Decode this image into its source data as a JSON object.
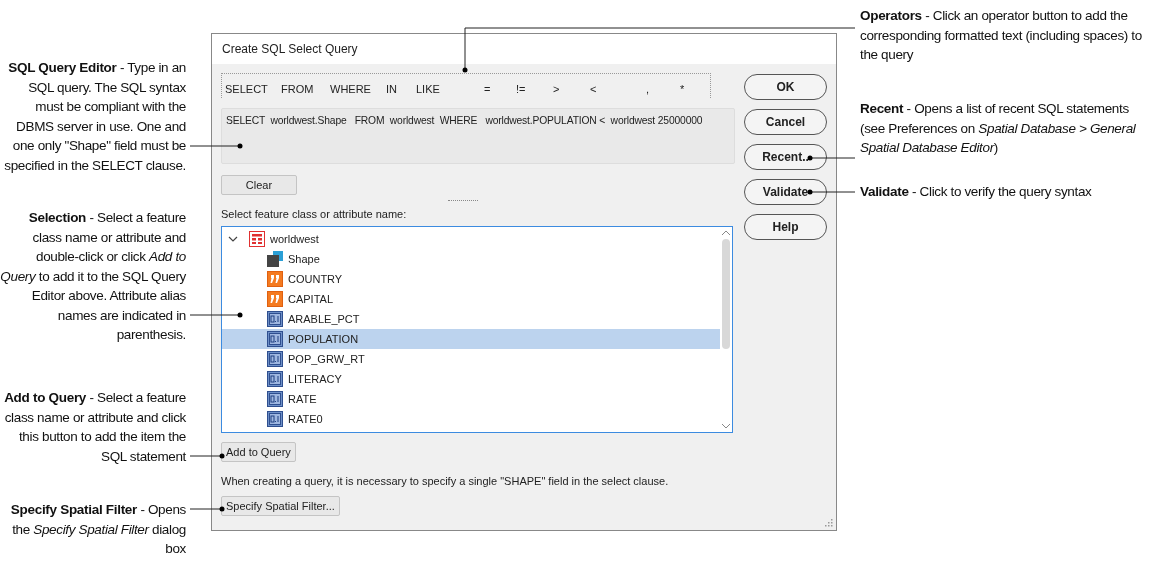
{
  "dialog": {
    "title": "Create SQL Select Query",
    "operators": [
      "SELECT",
      "FROM",
      "WHERE",
      "IN",
      "LIKE",
      "=",
      "!=",
      ">",
      "<",
      ",",
      "*"
    ],
    "query": "SELECT  worldwest.Shape   FROM  worldwest  WHERE   worldwest.POPULATION <  worldwest 25000000",
    "clear_button": "Clear",
    "tree_label": "Select feature class or attribute name:",
    "tree": {
      "label": "worldwest",
      "kind": "feature_class",
      "expanded": true,
      "selected": false,
      "children": [
        {
          "label": "Shape",
          "kind": "shape",
          "selected": false
        },
        {
          "label": "COUNTRY",
          "kind": "text",
          "selected": false
        },
        {
          "label": "CAPITAL",
          "kind": "text",
          "selected": false
        },
        {
          "label": "ARABLE_PCT",
          "kind": "number",
          "selected": false
        },
        {
          "label": "POPULATION",
          "kind": "number",
          "selected": true
        },
        {
          "label": "POP_GRW_RT",
          "kind": "number",
          "selected": false
        },
        {
          "label": "LITERACY",
          "kind": "number",
          "selected": false
        },
        {
          "label": "RATE",
          "kind": "number",
          "selected": false
        },
        {
          "label": "RATE0",
          "kind": "number",
          "selected": false
        }
      ]
    },
    "add_button": "Add to Query",
    "note": "When creating a query, it is necessary to specify a single \"SHAPE\" field in the select clause.",
    "spatial_filter_button": "Specify Spatial Filter...",
    "side_buttons": [
      "OK",
      "Cancel",
      "Recent..",
      "Validate",
      "Help"
    ]
  },
  "left_callouts": [
    "**SQL Query Editor** - Type in an SQL query. The SQL syntax must be compliant with the DBMS server in use. One and one only \"Shape\" field must be specified in the SELECT clause.",
    "**Selection** - Select a feature class name or attribute and double-click or click *Add to Query* to add it to the SQL Query Editor above. Attribute alias names are indicated in parenthesis.",
    "**Add to Query** - Select a feature class name or attribute and click this button to add the item the SQL statement",
    "**Specify Spatial Filter** - Opens the *Specify Spatial Filter* dialog box"
  ],
  "right_callouts": [
    "**Operators** - Click an operator button to add the corresponding formatted text (including spaces) to the query",
    "**Recent** - Opens a list of recent SQL statements (see Preferences on *Spatial Database > General Spatial Database Editor*)",
    "**Validate** - Click to verify the query syntax"
  ]
}
